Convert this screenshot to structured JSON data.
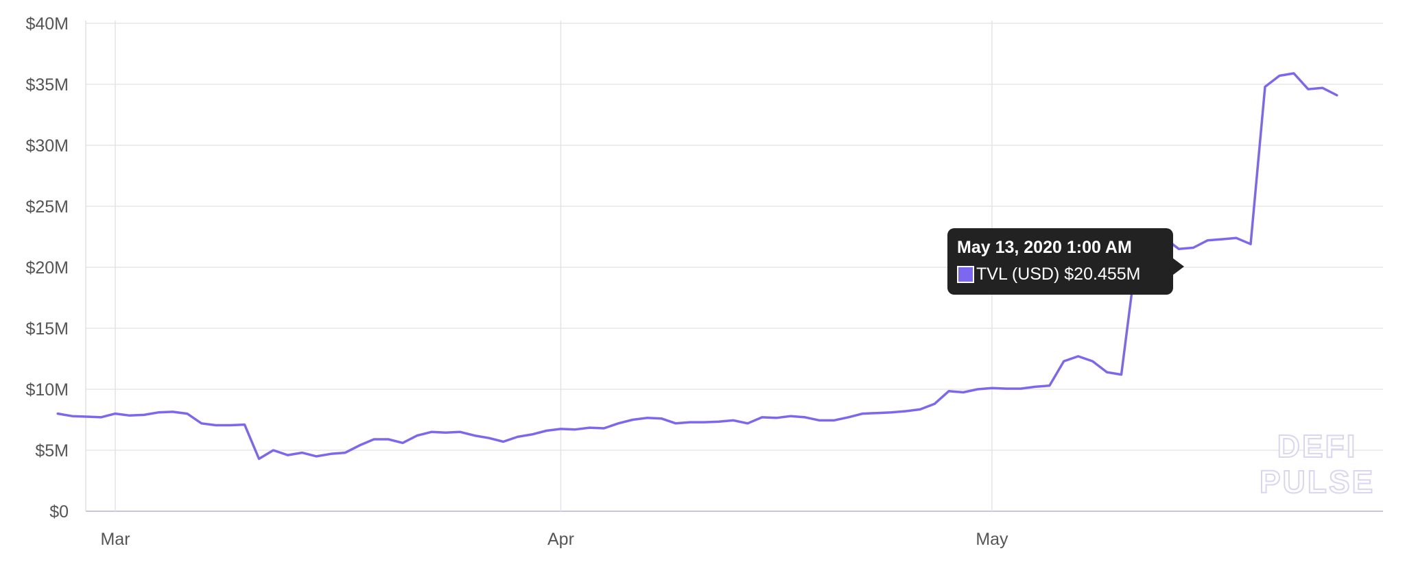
{
  "chart_data": {
    "type": "line",
    "series": [
      {
        "color": "#7b68ee",
        "points": [
          [
            "2020-02-26",
            8.0
          ],
          [
            "2020-02-27",
            7.8
          ],
          [
            "2020-02-28",
            7.75
          ],
          [
            "2020-02-29",
            7.7
          ],
          [
            "2020-03-01",
            8.0
          ],
          [
            "2020-03-02",
            7.85
          ],
          [
            "2020-03-03",
            7.9
          ],
          [
            "2020-03-04",
            8.1
          ],
          [
            "2020-03-05",
            8.15
          ],
          [
            "2020-03-06",
            8.0
          ],
          [
            "2020-03-07",
            7.2
          ],
          [
            "2020-03-08",
            7.05
          ],
          [
            "2020-03-09",
            7.05
          ],
          [
            "2020-03-10",
            7.1
          ],
          [
            "2020-03-11",
            4.3
          ],
          [
            "2020-03-12",
            5.0
          ],
          [
            "2020-03-13",
            4.6
          ],
          [
            "2020-03-14",
            4.8
          ],
          [
            "2020-03-15",
            4.5
          ],
          [
            "2020-03-16",
            4.7
          ],
          [
            "2020-03-17",
            4.8
          ],
          [
            "2020-03-18",
            5.4
          ],
          [
            "2020-03-19",
            5.9
          ],
          [
            "2020-03-20",
            5.9
          ],
          [
            "2020-03-21",
            5.6
          ],
          [
            "2020-03-22",
            6.2
          ],
          [
            "2020-03-23",
            6.5
          ],
          [
            "2020-03-24",
            6.45
          ],
          [
            "2020-03-25",
            6.5
          ],
          [
            "2020-03-26",
            6.2
          ],
          [
            "2020-03-27",
            6.0
          ],
          [
            "2020-03-28",
            5.7
          ],
          [
            "2020-03-29",
            6.1
          ],
          [
            "2020-03-30",
            6.3
          ],
          [
            "2020-03-31",
            6.6
          ],
          [
            "2020-04-01",
            6.75
          ],
          [
            "2020-04-02",
            6.7
          ],
          [
            "2020-04-03",
            6.85
          ],
          [
            "2020-04-04",
            6.8
          ],
          [
            "2020-04-05",
            7.2
          ],
          [
            "2020-04-06",
            7.5
          ],
          [
            "2020-04-07",
            7.65
          ],
          [
            "2020-04-08",
            7.6
          ],
          [
            "2020-04-09",
            7.2
          ],
          [
            "2020-04-10",
            7.3
          ],
          [
            "2020-04-11",
            7.3
          ],
          [
            "2020-04-12",
            7.35
          ],
          [
            "2020-04-13",
            7.45
          ],
          [
            "2020-04-14",
            7.2
          ],
          [
            "2020-04-15",
            7.7
          ],
          [
            "2020-04-16",
            7.65
          ],
          [
            "2020-04-17",
            7.8
          ],
          [
            "2020-04-18",
            7.7
          ],
          [
            "2020-04-19",
            7.45
          ],
          [
            "2020-04-20",
            7.45
          ],
          [
            "2020-04-21",
            7.7
          ],
          [
            "2020-04-22",
            8.0
          ],
          [
            "2020-04-23",
            8.05
          ],
          [
            "2020-04-24",
            8.1
          ],
          [
            "2020-04-25",
            8.2
          ],
          [
            "2020-04-26",
            8.35
          ],
          [
            "2020-04-27",
            8.8
          ],
          [
            "2020-04-28",
            9.85
          ],
          [
            "2020-04-29",
            9.75
          ],
          [
            "2020-04-30",
            10.0
          ],
          [
            "2020-05-01",
            10.1
          ],
          [
            "2020-05-02",
            10.05
          ],
          [
            "2020-05-03",
            10.05
          ],
          [
            "2020-05-04",
            10.2
          ],
          [
            "2020-05-05",
            10.3
          ],
          [
            "2020-05-06",
            12.3
          ],
          [
            "2020-05-07",
            12.7
          ],
          [
            "2020-05-08",
            12.3
          ],
          [
            "2020-05-09",
            11.4
          ],
          [
            "2020-05-10",
            11.2
          ],
          [
            "2020-05-11",
            20.455
          ],
          [
            "2020-05-12",
            21.4
          ],
          [
            "2020-05-13",
            22.4
          ],
          [
            "2020-05-14",
            21.5
          ],
          [
            "2020-05-15",
            21.6
          ],
          [
            "2020-05-16",
            22.2
          ],
          [
            "2020-05-17",
            22.3
          ],
          [
            "2020-05-18",
            22.4
          ],
          [
            "2020-05-19",
            21.9
          ],
          [
            "2020-05-20",
            34.8
          ],
          [
            "2020-05-21",
            35.7
          ],
          [
            "2020-05-22",
            35.9
          ],
          [
            "2020-05-23",
            34.6
          ],
          [
            "2020-05-24",
            34.7
          ],
          [
            "2020-05-25",
            34.1
          ]
        ]
      }
    ],
    "x_ticks": [
      "Mar",
      "Apr",
      "May"
    ],
    "y_ticks": [
      "$0",
      "$5M",
      "$10M",
      "$15M",
      "$20M",
      "$25M",
      "$30M",
      "$35M",
      "$40M"
    ],
    "ylim": [
      0,
      40
    ],
    "grid": true
  },
  "tooltip": {
    "title": "May 13, 2020 1:00 AM",
    "series_label": "TVL (USD)",
    "value": "$20.455M"
  },
  "watermark": {
    "line1": "DEFI",
    "line2": "PULSE"
  }
}
